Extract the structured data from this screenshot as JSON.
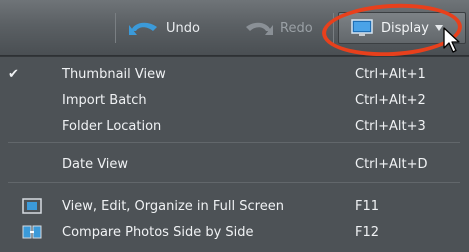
{
  "toolbar": {
    "undo_label": "Undo",
    "redo_label": "Redo",
    "display_label": "Display"
  },
  "menu": {
    "items": [
      {
        "label": "Thumbnail View",
        "shortcut": "Ctrl+Alt+1",
        "checked": true,
        "check_glyph": "✔"
      },
      {
        "label": "Import Batch",
        "shortcut": "Ctrl+Alt+2"
      },
      {
        "label": "Folder Location",
        "shortcut": "Ctrl+Alt+3"
      },
      {
        "label": "Date View",
        "shortcut": "Ctrl+Alt+D"
      },
      {
        "label": "View, Edit, Organize in Full Screen",
        "shortcut": "F11",
        "icon": "full-screen-icon"
      },
      {
        "label": "Compare Photos Side by Side",
        "shortcut": "F12",
        "icon": "compare-side-by-side-icon"
      }
    ]
  },
  "colors": {
    "highlight_ring": "#e8401c",
    "undo_icon": "#3b9ad9",
    "menu_bg": "#4d5256",
    "toolbar_bg": "#5b6064"
  }
}
